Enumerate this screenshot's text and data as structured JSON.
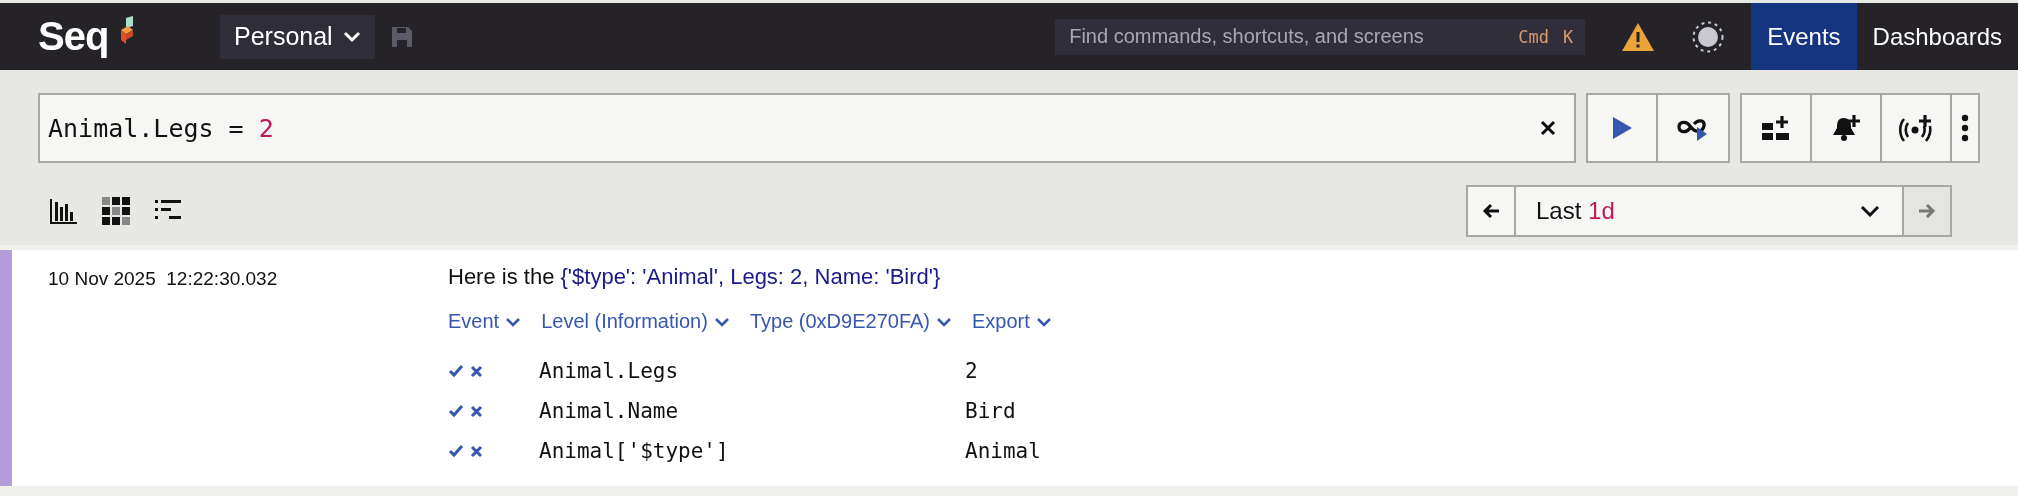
{
  "app": {
    "logo": "Seq"
  },
  "workspace": {
    "label": "Personal"
  },
  "command_search": {
    "placeholder": "Find commands, shortcuts, and screens",
    "shortcut": [
      "Cmd",
      "K"
    ]
  },
  "nav_tabs": [
    {
      "label": "Events",
      "selected": true
    },
    {
      "label": "Dashboards",
      "selected": false
    }
  ],
  "query": {
    "parts": [
      {
        "text": "Animal.Legs = ",
        "kind": "plain"
      },
      {
        "text": "2",
        "kind": "number"
      }
    ]
  },
  "time_range": {
    "parts": [
      {
        "text": "Last ",
        "kind": "plain"
      },
      {
        "text": "1d",
        "kind": "number"
      }
    ],
    "next_disabled": true
  },
  "event": {
    "color": "#b39ddb",
    "timestamp": "10 Nov 2025  12:22:30.032",
    "message": [
      {
        "text": "Here is the ",
        "kind": "plain"
      },
      {
        "text": "{'$type': 'Animal', Legs: 2, Name: 'Bird'}",
        "kind": "value"
      }
    ],
    "menus": [
      {
        "label": "Event"
      },
      {
        "label": "Level (Information)"
      },
      {
        "label": "Type (0xD9E270FA)"
      },
      {
        "label": "Export"
      }
    ],
    "properties": [
      {
        "name": "Animal.Legs",
        "value": "2"
      },
      {
        "name": "Animal.Name",
        "value": "Bird"
      },
      {
        "name": "Animal['$type']",
        "value": "Animal"
      }
    ]
  }
}
